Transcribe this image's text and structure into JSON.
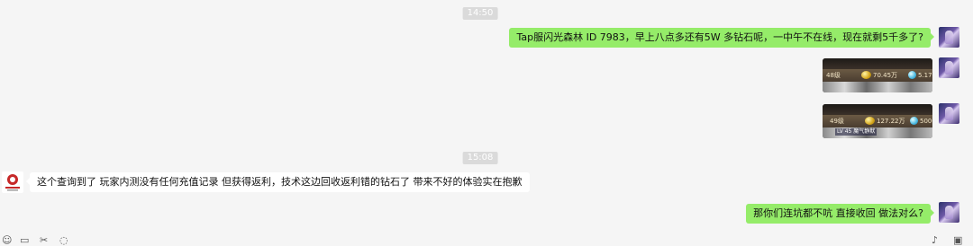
{
  "chat": {
    "time_1": "14:50",
    "time_2": "15:08",
    "messages": [
      {
        "from": "me",
        "text": "Tap服闪光森林  ID 7983，早上八点多还有5W 多钻石呢，一中午不在线，现在就剩5千多了?"
      },
      {
        "from": "other",
        "text": "这个查询到了 玩家内测没有任何充值记录 但获得返利，技术这边回收返利错的钻石了 带来不好的体验实在抱歉"
      },
      {
        "from": "me",
        "text": "那你们连坑都不吭 直接收回   做法对么?"
      }
    ],
    "screenshots": [
      {
        "level": "48级",
        "gold": "70.45万",
        "diamond": "5.17"
      },
      {
        "level": "49级",
        "gold": "127.22万",
        "diamond": "5000",
        "tag": "LV 45 魔气静默"
      }
    ]
  },
  "toolbar": {
    "icons": [
      "emoji-icon",
      "folder-icon",
      "scissors-icon",
      "chat-history-icon",
      "microphone-icon",
      "video-call-icon"
    ]
  },
  "colors": {
    "background": "#f5f5f5",
    "my_bubble": "#95ec69",
    "other_bubble": "#ffffff",
    "timestamp_bg": "#dadada"
  }
}
